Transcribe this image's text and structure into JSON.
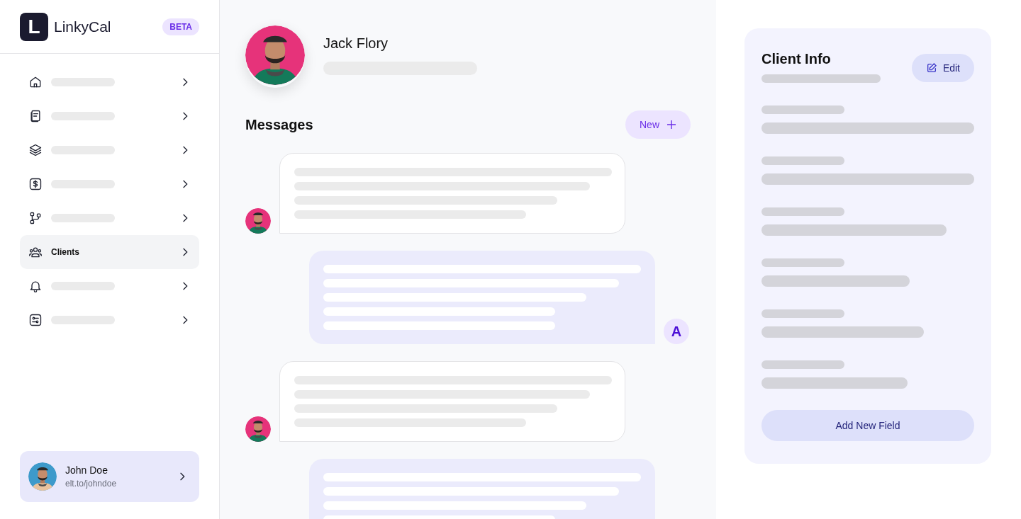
{
  "brand": {
    "name": "LinkyCal",
    "logo_letter": "L",
    "badge": "BETA"
  },
  "nav": [
    {
      "selected": false
    },
    {
      "selected": false
    },
    {
      "selected": false
    },
    {
      "selected": false
    },
    {
      "selected": false
    },
    {
      "label": "Clients",
      "selected": true
    },
    {
      "selected": false
    },
    {
      "selected": false
    }
  ],
  "user": {
    "name": "John Doe",
    "link": "elt.to/johndoe"
  },
  "client": {
    "name": "Jack Flory"
  },
  "messages": {
    "title": "Messages",
    "new_button": "New",
    "items": [
      {
        "kind": "incoming"
      },
      {
        "kind": "outgoing",
        "avatar": "A"
      },
      {
        "kind": "incoming"
      },
      {
        "kind": "outgoing"
      }
    ]
  },
  "client_info": {
    "title": "Client Info",
    "edit_button": "Edit",
    "add_button": "Add New Field"
  }
}
